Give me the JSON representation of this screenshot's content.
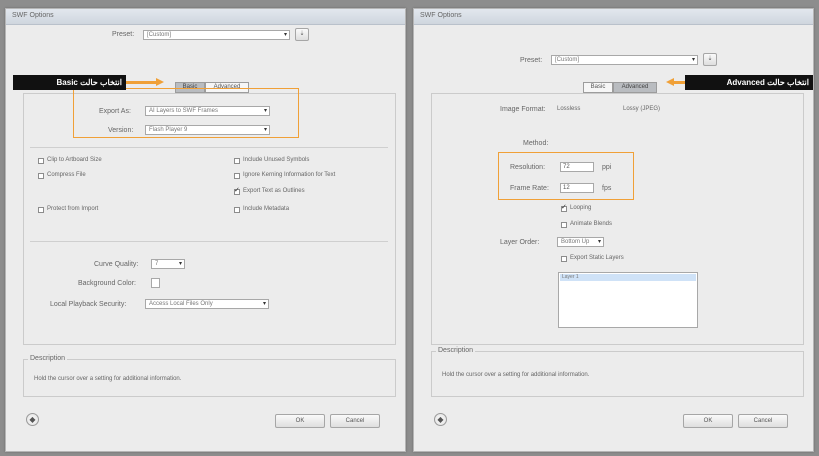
{
  "left_dialog": {
    "title": "SWF Options",
    "preset_label": "Preset:",
    "preset_value": "[Custom]",
    "tabs": [
      {
        "label": "Basic",
        "active": true
      },
      {
        "label": "Advanced",
        "active": false
      }
    ],
    "export_as_label": "Export As:",
    "export_as_value": "AI Layers to SWF Frames",
    "version_label": "Version:",
    "version_value": "Flash Player 9",
    "options_left": [
      {
        "label": "Clip to Artboard Size",
        "checked": false
      },
      {
        "label": "Compress File",
        "checked": false
      },
      {
        "label": "Protect from Import",
        "checked": false
      }
    ],
    "options_right": [
      {
        "label": "Include Unused Symbols",
        "checked": false
      },
      {
        "label": "Ignore Kerning Information for Text",
        "checked": false
      },
      {
        "label": "Export Text as Outlines",
        "checked": true
      },
      {
        "label": "Include Metadata",
        "checked": false
      }
    ],
    "curve_quality_label": "Curve Quality:",
    "curve_quality_value": "7",
    "bg_color_label": "Background Color:",
    "local_playback_label": "Local Playback Security:",
    "local_playback_value": "Access Local Files Only",
    "description_legend": "Description",
    "description_text": "Hold the cursor over a setting for additional information.",
    "ok_label": "OK",
    "cancel_label": "Cancel",
    "callout": "انتخاب حالت Basic"
  },
  "right_dialog": {
    "title": "SWF Options",
    "preset_label": "Preset:",
    "preset_value": "[Custom]",
    "tabs": [
      {
        "label": "Basic",
        "active": false
      },
      {
        "label": "Advanced",
        "active": true
      }
    ],
    "image_format_label": "Image Format:",
    "lossless_label": "Lossless",
    "lossy_label": "Lossy (JPEG)",
    "method_label": "Method:",
    "resolution_label": "Resolution:",
    "resolution_value": "72",
    "resolution_unit": "ppi",
    "frame_rate_label": "Frame Rate:",
    "frame_rate_value": "12",
    "frame_rate_unit": "fps",
    "looping_label": "Looping",
    "looping_checked": true,
    "animate_blends_label": "Animate Blends",
    "animate_blends_checked": false,
    "layer_order_label": "Layer Order:",
    "layer_order_value": "Bottom Up",
    "static_layers_label": "Export Static Layers",
    "static_layers_checked": false,
    "list_item": "Layer 1",
    "description_legend": "Description",
    "description_text": "Hold the cursor over a setting for additional information.",
    "ok_label": "OK",
    "cancel_label": "Cancel",
    "callout": "انتخاب حالت Advanced"
  },
  "colors": {
    "highlight": "#f0a037",
    "callout_bg": "#111111",
    "callout_arrow": "#f0a037"
  }
}
